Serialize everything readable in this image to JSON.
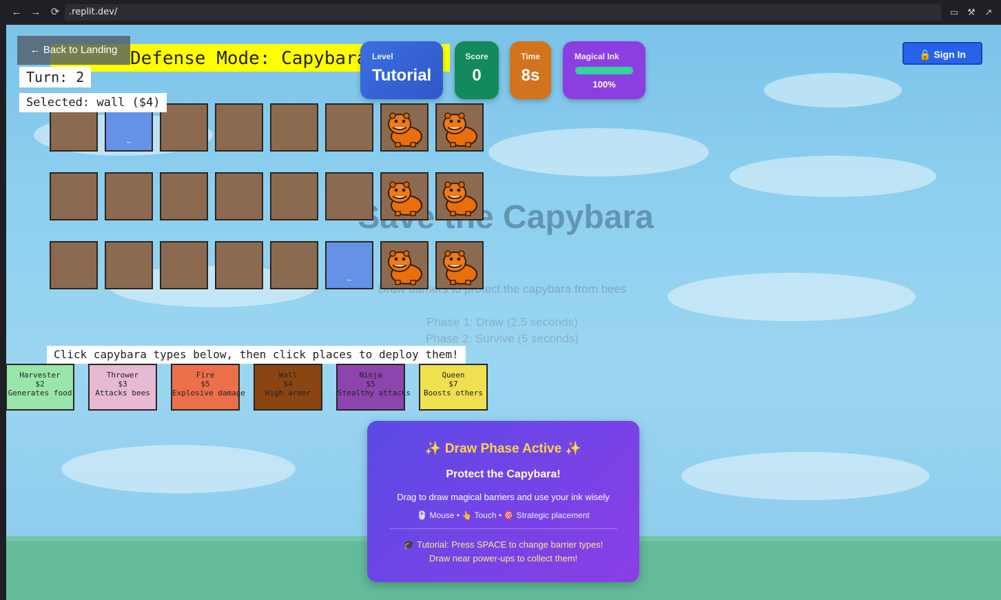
{
  "browser": {
    "url": ".replit.dev/",
    "back": "←",
    "forward": "→",
    "reload": "⟳"
  },
  "background": {
    "title": "Save the Capybara",
    "subtitle": "Draw barriers to protect the capybara from bees",
    "phase1": "Phase 1: Draw (2.5 seconds)",
    "phase2": "Phase 2: Survive (5 seconds)"
  },
  "defense": {
    "title": "Defense Mode: Capybara",
    "back_label": "← Back to Landing",
    "turn": "Turn: 2",
    "selected": "Selected: wall ($4)",
    "hint": "Click capybara types below, then click places to deploy them!",
    "cell_water_mark": "~",
    "cards": [
      {
        "name": "Harvester",
        "cost": "$2",
        "desc": "Generates food",
        "color": "#98e6aa"
      },
      {
        "name": "Thrower",
        "cost": "$3",
        "desc": "Attacks bees",
        "color": "#e7b9d3"
      },
      {
        "name": "Fire",
        "cost": "$5",
        "desc": "Explosive damage",
        "color": "#ec6f4a"
      },
      {
        "name": "Wall",
        "cost": "$4",
        "desc": "High armor",
        "color": "#8b4513"
      },
      {
        "name": "Ninja",
        "cost": "$5",
        "desc": "Stealthy attacks",
        "color": "#8e44ad"
      },
      {
        "name": "Queen",
        "cost": "$7",
        "desc": "Boosts others",
        "color": "#f0e050"
      }
    ]
  },
  "stats": {
    "level_label": "Level",
    "level_value": "Tutorial",
    "score_label": "Score",
    "score_value": "0",
    "time_label": "Time",
    "time_value": "8s",
    "ink_label": "Magical Ink",
    "ink_value": "100%",
    "ink_fraction": 1.0,
    "colors": {
      "level": "#3b6fe0",
      "score": "#128a5c",
      "time": "#d2741c",
      "ink": "#8b3fe0"
    }
  },
  "auth": {
    "signin": "🔒 Sign In"
  },
  "panel": {
    "title": "✨ Draw Phase Active ✨",
    "subtitle": "Protect the Capybara!",
    "desc": "Drag to draw magical barriers and use your ink wisely",
    "inputs": "🖱️ Mouse • 👆 Touch • 🎯 Strategic placement",
    "tip1": "🎓 Tutorial: Press SPACE to change barrier types!",
    "tip2": "Draw near power-ups to collect them!"
  }
}
